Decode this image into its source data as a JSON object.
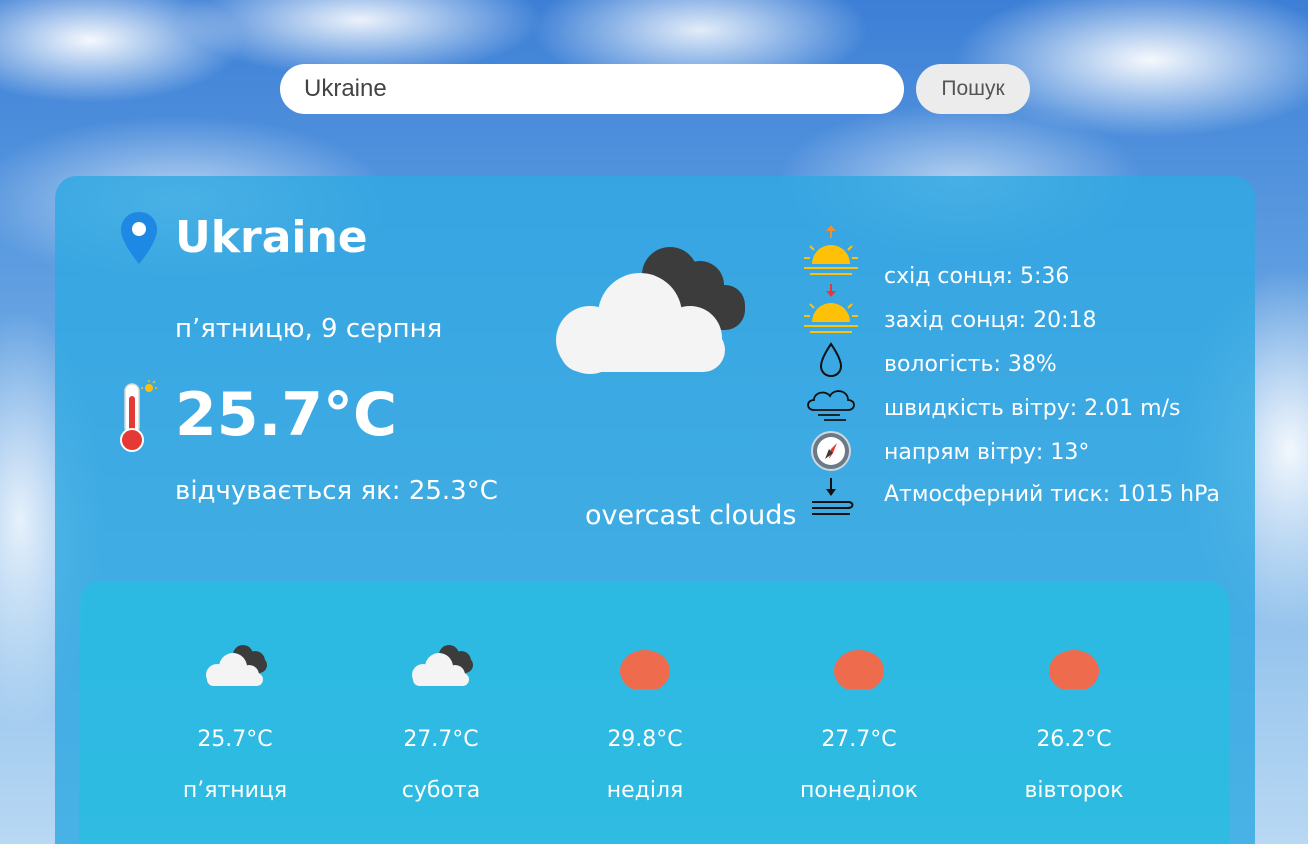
{
  "search": {
    "value": "Ukraine",
    "button_label": "Пошук"
  },
  "current": {
    "city": "Ukraine",
    "date": "п’ятницю, 9 серпня",
    "temperature": "25.7°C",
    "feels_like": "відчувається як: 25.3°C",
    "condition": "overcast clouds",
    "icon": "overcast-clouds-icon"
  },
  "details": [
    {
      "icon": "sunrise-icon",
      "text": "схід сонця: 5:36"
    },
    {
      "icon": "sunset-icon",
      "text": "захід сонця: 20:18"
    },
    {
      "icon": "humidity-drop-icon",
      "text": "вологість: 38%"
    },
    {
      "icon": "wind-cloud-icon",
      "text": "швидкість вітру: 2.01 m/s"
    },
    {
      "icon": "compass-icon",
      "text": "напрям вітру: 13°"
    },
    {
      "icon": "pressure-icon",
      "text": "Атмосферний тиск: 1015 hPa"
    }
  ],
  "forecast": [
    {
      "icon": "broken-clouds-icon",
      "temp": "25.7°C",
      "day": "п’ятниця"
    },
    {
      "icon": "broken-clouds-icon",
      "temp": "27.7°C",
      "day": "субота"
    },
    {
      "icon": "sun-icon",
      "temp": "29.8°C",
      "day": "неділя"
    },
    {
      "icon": "sun-icon",
      "temp": "27.7°C",
      "day": "понеділок"
    },
    {
      "icon": "sun-icon",
      "temp": "26.2°C",
      "day": "вівторок"
    }
  ],
  "colors": {
    "sun": "#ee6b4d",
    "card": "#30a8e2",
    "forecast_panel": "#28bee1"
  }
}
